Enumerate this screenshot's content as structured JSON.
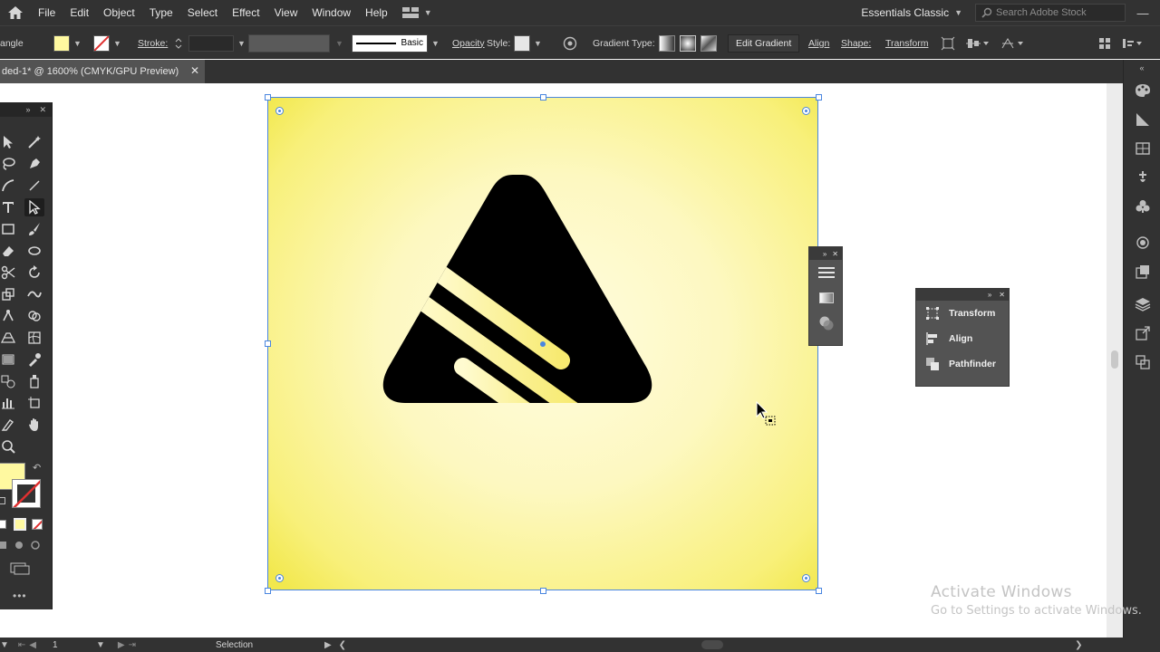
{
  "menubar": {
    "items": [
      "File",
      "Edit",
      "Object",
      "Type",
      "Select",
      "Effect",
      "View",
      "Window",
      "Help"
    ],
    "workspace": "Essentials Classic",
    "search_placeholder": "Search Adobe Stock"
  },
  "controlbar": {
    "object_type": "angle",
    "stroke_label": "Stroke:",
    "brush_style": "Basic",
    "opacity_label": "Opacity",
    "style_label": "Style:",
    "gradient_type_label": "Gradient Type:",
    "edit_gradient": "Edit Gradient",
    "align": "Align",
    "shape": "Shape:",
    "transform": "Transform",
    "fill_color": "#fff9a0"
  },
  "document": {
    "tab_title": "ded-1* @ 1600% (CMYK/GPU Preview)"
  },
  "panels": {
    "items": [
      "Transform",
      "Align",
      "Pathfinder"
    ]
  },
  "statusbar": {
    "artboard_number": "1",
    "tool": "Selection"
  },
  "watermark": {
    "line1": "Activate Windows",
    "line2": "Go to Settings to activate Windows."
  },
  "colors": {
    "ui_dark": "#323232",
    "selection": "#4a86e0",
    "artboard_yellow": "#f8f07a",
    "logo_black": "#000000"
  }
}
